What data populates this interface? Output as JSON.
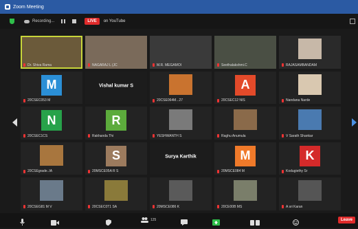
{
  "window": {
    "title": "Zoom Meeting"
  },
  "topbar": {
    "recording_label": "Recording...",
    "live_label": "LIVE",
    "stream_label": "on YouTube"
  },
  "participants": [
    {
      "name": "Dr. Shiva Rama",
      "bg": "#6b5a3a",
      "kind": "video"
    },
    {
      "name": "NAGARAJ L (JC",
      "bg": "#7a6a5a",
      "kind": "video"
    },
    {
      "name": "M.R. MEGAMOI",
      "bg": "#3a3a3a",
      "kind": "video"
    },
    {
      "name": "Seethalakshmi.C",
      "bg": "#4a4f44",
      "kind": "video"
    },
    {
      "name": "RAJASAMBANDAM",
      "bg": "#2a2a2a",
      "kind": "photo",
      "pic": "#c7b8a8"
    },
    {
      "name": "20CSEC053 M",
      "bg": "#232323",
      "kind": "avatar",
      "letter": "M",
      "color": "#2b8fd6"
    },
    {
      "name": "",
      "bg": "#1c1c1c",
      "kind": "label",
      "big_name": "Vishal kumar S"
    },
    {
      "name": "20CSE064M...27",
      "bg": "#232323",
      "kind": "photo",
      "pic": "#c9732f"
    },
    {
      "name": "20CSEC12 NIS",
      "bg": "#232323",
      "kind": "avatar",
      "letter": "A",
      "color": "#e34a2a"
    },
    {
      "name": "Nandana Narde",
      "bg": "#232323",
      "kind": "photo",
      "pic": "#d9c8b0"
    },
    {
      "name": "20CSEC1CS",
      "bg": "#232323",
      "kind": "avatar",
      "letter": "N",
      "color": "#27a24a"
    },
    {
      "name": "Rakhanda Thi",
      "bg": "#232323",
      "kind": "avatar",
      "letter": "R",
      "color": "#5cab3c"
    },
    {
      "name": "YESHWANTH S",
      "bg": "#232323",
      "kind": "photo",
      "pic": "#7a7a7a"
    },
    {
      "name": "Raghu Anumula",
      "bg": "#232323",
      "kind": "photo",
      "pic": "#8a6a4a"
    },
    {
      "name": "V Sarath Shankar",
      "bg": "#232323",
      "kind": "photo",
      "pic": "#4a7ab0"
    },
    {
      "name": "20CSEgrade..IA",
      "bg": "#232323",
      "kind": "photo",
      "pic": "#a8763e"
    },
    {
      "name": "20MSCE05A R S",
      "bg": "#232323",
      "kind": "avatar",
      "letter": "S",
      "color": "#9c7b5e"
    },
    {
      "name": "",
      "bg": "#1c1c1c",
      "kind": "label",
      "big_name": "Surya Karthik"
    },
    {
      "name": "20MSCE084 M",
      "bg": "#232323",
      "kind": "avatar",
      "letter": "M",
      "color": "#f07a2a"
    },
    {
      "name": "Kodugiethy Sr",
      "bg": "#232323",
      "kind": "avatar",
      "letter": "K",
      "color": "#d42a2a"
    },
    {
      "name": "20CSEG81 M V",
      "bg": "#232323",
      "kind": "photo",
      "pic": "#6a7a8a"
    },
    {
      "name": "20CSEC0T1 SA",
      "bg": "#232323",
      "kind": "photo",
      "pic": "#8a7a3a"
    },
    {
      "name": "20MSCE086 K",
      "bg": "#232323",
      "kind": "photo",
      "pic": "#5a5a5a"
    },
    {
      "name": "20CE00B MS",
      "bg": "#232323",
      "kind": "photo",
      "pic": "#7a7e6a"
    },
    {
      "name": "A sri Karan",
      "bg": "#232323",
      "kind": "photo",
      "pic": "#555555"
    }
  ],
  "toolbar": {
    "participants_count": "125",
    "leave_label": "Leave"
  },
  "icons": {
    "mute": "microphone-icon",
    "video": "camera-icon",
    "security": "shield-icon",
    "participants": "people-icon",
    "chat": "chat-icon",
    "share": "share-screen-icon",
    "record": "record-icon",
    "reactions": "reactions-icon"
  }
}
